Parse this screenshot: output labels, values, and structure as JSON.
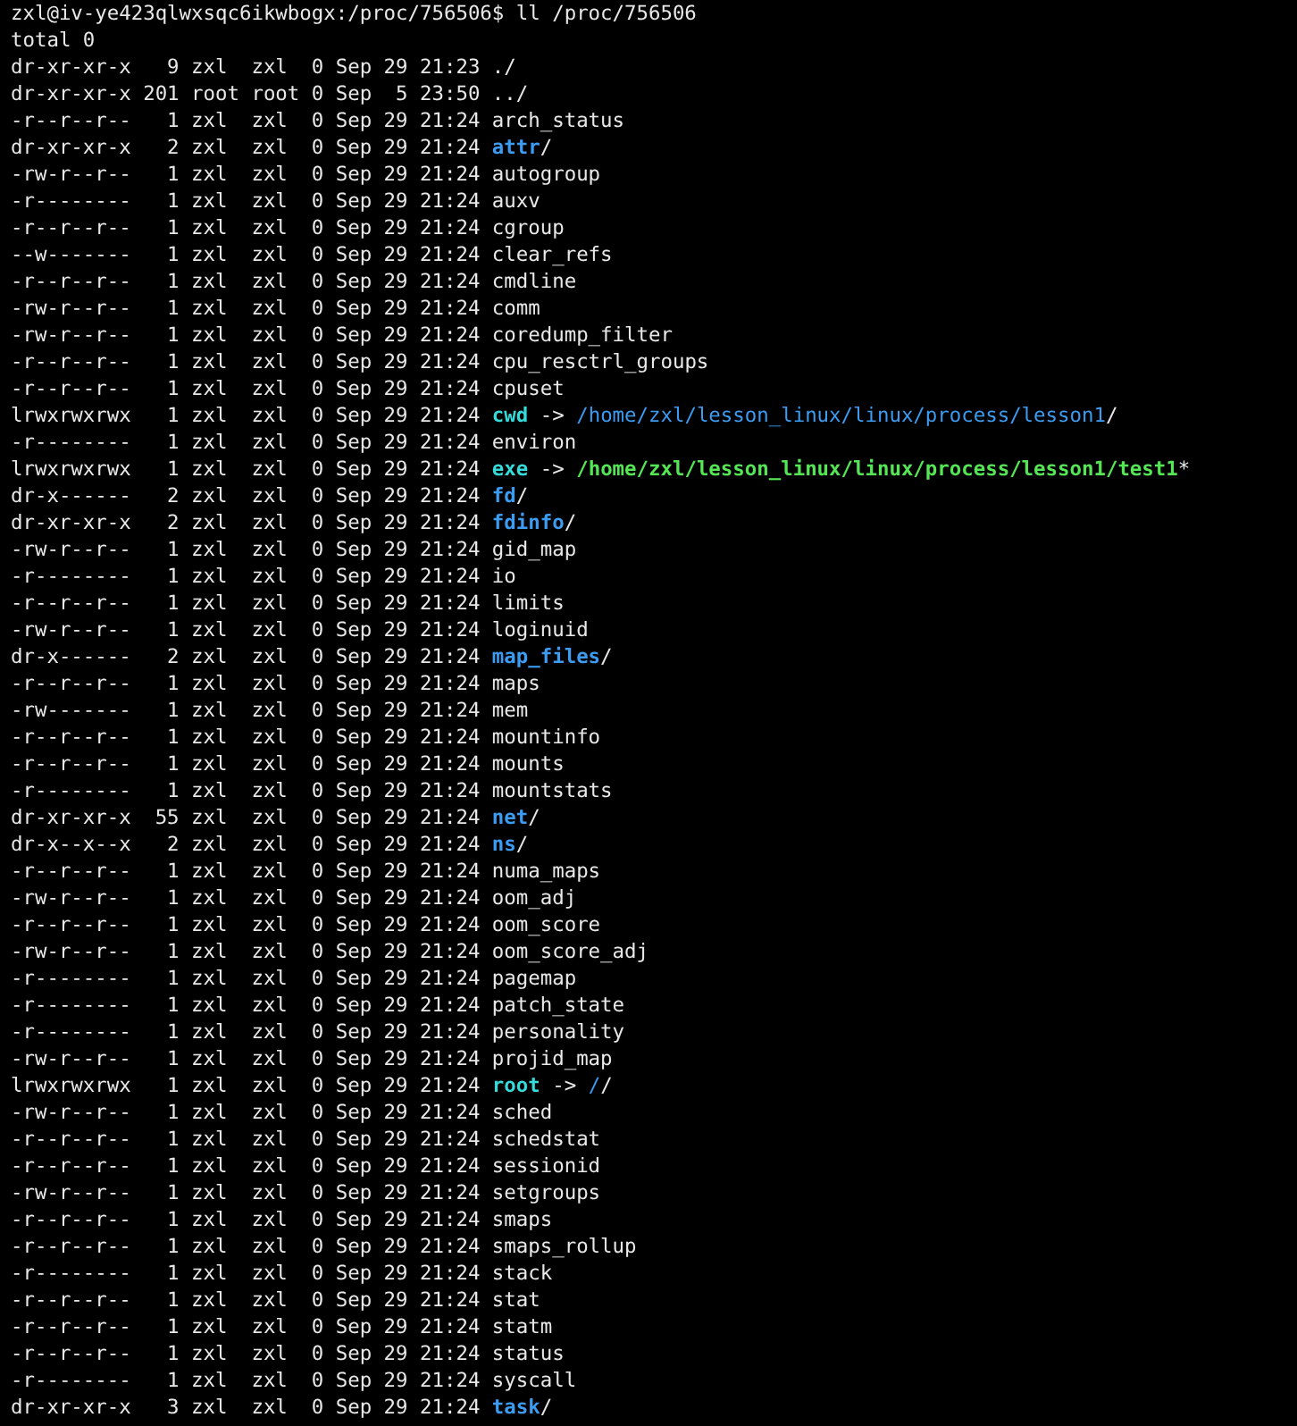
{
  "terminal": {
    "prompt": "zxl@iv-ye423qlwxsqc6ikwbogx:/proc/756506$ ll /proc/756506",
    "total": "total 0",
    "entries": [
      {
        "perms": "dr-xr-xr-x",
        "links": "9",
        "owner": "zxl",
        "group": "zxl",
        "size": "0",
        "date": "Sep 29",
        "time": "21:23",
        "name": ".",
        "kind": "plain",
        "suffix": "/"
      },
      {
        "perms": "dr-xr-xr-x",
        "links": "201",
        "owner": "root",
        "group": "root",
        "size": "0",
        "date": "Sep  5",
        "time": "23:50",
        "name": "..",
        "kind": "plain",
        "suffix": "/"
      },
      {
        "perms": "-r--r--r--",
        "links": "1",
        "owner": "zxl",
        "group": "zxl",
        "size": "0",
        "date": "Sep 29",
        "time": "21:24",
        "name": "arch_status",
        "kind": "plain"
      },
      {
        "perms": "dr-xr-xr-x",
        "links": "2",
        "owner": "zxl",
        "group": "zxl",
        "size": "0",
        "date": "Sep 29",
        "time": "21:24",
        "name": "attr",
        "kind": "dir",
        "suffix": "/"
      },
      {
        "perms": "-rw-r--r--",
        "links": "1",
        "owner": "zxl",
        "group": "zxl",
        "size": "0",
        "date": "Sep 29",
        "time": "21:24",
        "name": "autogroup",
        "kind": "plain"
      },
      {
        "perms": "-r--------",
        "links": "1",
        "owner": "zxl",
        "group": "zxl",
        "size": "0",
        "date": "Sep 29",
        "time": "21:24",
        "name": "auxv",
        "kind": "plain"
      },
      {
        "perms": "-r--r--r--",
        "links": "1",
        "owner": "zxl",
        "group": "zxl",
        "size": "0",
        "date": "Sep 29",
        "time": "21:24",
        "name": "cgroup",
        "kind": "plain"
      },
      {
        "perms": "--w-------",
        "links": "1",
        "owner": "zxl",
        "group": "zxl",
        "size": "0",
        "date": "Sep 29",
        "time": "21:24",
        "name": "clear_refs",
        "kind": "plain"
      },
      {
        "perms": "-r--r--r--",
        "links": "1",
        "owner": "zxl",
        "group": "zxl",
        "size": "0",
        "date": "Sep 29",
        "time": "21:24",
        "name": "cmdline",
        "kind": "plain"
      },
      {
        "perms": "-rw-r--r--",
        "links": "1",
        "owner": "zxl",
        "group": "zxl",
        "size": "0",
        "date": "Sep 29",
        "time": "21:24",
        "name": "comm",
        "kind": "plain"
      },
      {
        "perms": "-rw-r--r--",
        "links": "1",
        "owner": "zxl",
        "group": "zxl",
        "size": "0",
        "date": "Sep 29",
        "time": "21:24",
        "name": "coredump_filter",
        "kind": "plain"
      },
      {
        "perms": "-r--r--r--",
        "links": "1",
        "owner": "zxl",
        "group": "zxl",
        "size": "0",
        "date": "Sep 29",
        "time": "21:24",
        "name": "cpu_resctrl_groups",
        "kind": "plain"
      },
      {
        "perms": "-r--r--r--",
        "links": "1",
        "owner": "zxl",
        "group": "zxl",
        "size": "0",
        "date": "Sep 29",
        "time": "21:24",
        "name": "cpuset",
        "kind": "plain"
      },
      {
        "perms": "lrwxrwxrwx",
        "links": "1",
        "owner": "zxl",
        "group": "zxl",
        "size": "0",
        "date": "Sep 29",
        "time": "21:24",
        "name": "cwd",
        "kind": "link",
        "arrow": "->",
        "target": {
          "path": "/home/zxl/lesson_linux/linux/process/lesson1",
          "kind": "dir"
        },
        "suffix": "/"
      },
      {
        "perms": "-r--------",
        "links": "1",
        "owner": "zxl",
        "group": "zxl",
        "size": "0",
        "date": "Sep 29",
        "time": "21:24",
        "name": "environ",
        "kind": "plain"
      },
      {
        "perms": "lrwxrwxrwx",
        "links": "1",
        "owner": "zxl",
        "group": "zxl",
        "size": "0",
        "date": "Sep 29",
        "time": "21:24",
        "name": "exe",
        "kind": "link",
        "arrow": "->",
        "target": {
          "path": "/home/zxl/lesson_linux/linux/process/lesson1/test1",
          "kind": "exec"
        },
        "suffix": "*"
      },
      {
        "perms": "dr-x------",
        "links": "2",
        "owner": "zxl",
        "group": "zxl",
        "size": "0",
        "date": "Sep 29",
        "time": "21:24",
        "name": "fd",
        "kind": "dir",
        "suffix": "/"
      },
      {
        "perms": "dr-xr-xr-x",
        "links": "2",
        "owner": "zxl",
        "group": "zxl",
        "size": "0",
        "date": "Sep 29",
        "time": "21:24",
        "name": "fdinfo",
        "kind": "dir",
        "suffix": "/"
      },
      {
        "perms": "-rw-r--r--",
        "links": "1",
        "owner": "zxl",
        "group": "zxl",
        "size": "0",
        "date": "Sep 29",
        "time": "21:24",
        "name": "gid_map",
        "kind": "plain"
      },
      {
        "perms": "-r--------",
        "links": "1",
        "owner": "zxl",
        "group": "zxl",
        "size": "0",
        "date": "Sep 29",
        "time": "21:24",
        "name": "io",
        "kind": "plain"
      },
      {
        "perms": "-r--r--r--",
        "links": "1",
        "owner": "zxl",
        "group": "zxl",
        "size": "0",
        "date": "Sep 29",
        "time": "21:24",
        "name": "limits",
        "kind": "plain"
      },
      {
        "perms": "-rw-r--r--",
        "links": "1",
        "owner": "zxl",
        "group": "zxl",
        "size": "0",
        "date": "Sep 29",
        "time": "21:24",
        "name": "loginuid",
        "kind": "plain"
      },
      {
        "perms": "dr-x------",
        "links": "2",
        "owner": "zxl",
        "group": "zxl",
        "size": "0",
        "date": "Sep 29",
        "time": "21:24",
        "name": "map_files",
        "kind": "dir",
        "suffix": "/"
      },
      {
        "perms": "-r--r--r--",
        "links": "1",
        "owner": "zxl",
        "group": "zxl",
        "size": "0",
        "date": "Sep 29",
        "time": "21:24",
        "name": "maps",
        "kind": "plain"
      },
      {
        "perms": "-rw-------",
        "links": "1",
        "owner": "zxl",
        "group": "zxl",
        "size": "0",
        "date": "Sep 29",
        "time": "21:24",
        "name": "mem",
        "kind": "plain"
      },
      {
        "perms": "-r--r--r--",
        "links": "1",
        "owner": "zxl",
        "group": "zxl",
        "size": "0",
        "date": "Sep 29",
        "time": "21:24",
        "name": "mountinfo",
        "kind": "plain"
      },
      {
        "perms": "-r--r--r--",
        "links": "1",
        "owner": "zxl",
        "group": "zxl",
        "size": "0",
        "date": "Sep 29",
        "time": "21:24",
        "name": "mounts",
        "kind": "plain"
      },
      {
        "perms": "-r--------",
        "links": "1",
        "owner": "zxl",
        "group": "zxl",
        "size": "0",
        "date": "Sep 29",
        "time": "21:24",
        "name": "mountstats",
        "kind": "plain"
      },
      {
        "perms": "dr-xr-xr-x",
        "links": "55",
        "owner": "zxl",
        "group": "zxl",
        "size": "0",
        "date": "Sep 29",
        "time": "21:24",
        "name": "net",
        "kind": "dir",
        "suffix": "/"
      },
      {
        "perms": "dr-x--x--x",
        "links": "2",
        "owner": "zxl",
        "group": "zxl",
        "size": "0",
        "date": "Sep 29",
        "time": "21:24",
        "name": "ns",
        "kind": "dir",
        "suffix": "/"
      },
      {
        "perms": "-r--r--r--",
        "links": "1",
        "owner": "zxl",
        "group": "zxl",
        "size": "0",
        "date": "Sep 29",
        "time": "21:24",
        "name": "numa_maps",
        "kind": "plain"
      },
      {
        "perms": "-rw-r--r--",
        "links": "1",
        "owner": "zxl",
        "group": "zxl",
        "size": "0",
        "date": "Sep 29",
        "time": "21:24",
        "name": "oom_adj",
        "kind": "plain"
      },
      {
        "perms": "-r--r--r--",
        "links": "1",
        "owner": "zxl",
        "group": "zxl",
        "size": "0",
        "date": "Sep 29",
        "time": "21:24",
        "name": "oom_score",
        "kind": "plain"
      },
      {
        "perms": "-rw-r--r--",
        "links": "1",
        "owner": "zxl",
        "group": "zxl",
        "size": "0",
        "date": "Sep 29",
        "time": "21:24",
        "name": "oom_score_adj",
        "kind": "plain"
      },
      {
        "perms": "-r--------",
        "links": "1",
        "owner": "zxl",
        "group": "zxl",
        "size": "0",
        "date": "Sep 29",
        "time": "21:24",
        "name": "pagemap",
        "kind": "plain"
      },
      {
        "perms": "-r--------",
        "links": "1",
        "owner": "zxl",
        "group": "zxl",
        "size": "0",
        "date": "Sep 29",
        "time": "21:24",
        "name": "patch_state",
        "kind": "plain"
      },
      {
        "perms": "-r--------",
        "links": "1",
        "owner": "zxl",
        "group": "zxl",
        "size": "0",
        "date": "Sep 29",
        "time": "21:24",
        "name": "personality",
        "kind": "plain"
      },
      {
        "perms": "-rw-r--r--",
        "links": "1",
        "owner": "zxl",
        "group": "zxl",
        "size": "0",
        "date": "Sep 29",
        "time": "21:24",
        "name": "projid_map",
        "kind": "plain"
      },
      {
        "perms": "lrwxrwxrwx",
        "links": "1",
        "owner": "zxl",
        "group": "zxl",
        "size": "0",
        "date": "Sep 29",
        "time": "21:24",
        "name": "root",
        "kind": "link",
        "arrow": "->",
        "target": {
          "path": "/",
          "kind": "dir"
        },
        "suffix": "/"
      },
      {
        "perms": "-rw-r--r--",
        "links": "1",
        "owner": "zxl",
        "group": "zxl",
        "size": "0",
        "date": "Sep 29",
        "time": "21:24",
        "name": "sched",
        "kind": "plain"
      },
      {
        "perms": "-r--r--r--",
        "links": "1",
        "owner": "zxl",
        "group": "zxl",
        "size": "0",
        "date": "Sep 29",
        "time": "21:24",
        "name": "schedstat",
        "kind": "plain"
      },
      {
        "perms": "-r--r--r--",
        "links": "1",
        "owner": "zxl",
        "group": "zxl",
        "size": "0",
        "date": "Sep 29",
        "time": "21:24",
        "name": "sessionid",
        "kind": "plain"
      },
      {
        "perms": "-rw-r--r--",
        "links": "1",
        "owner": "zxl",
        "group": "zxl",
        "size": "0",
        "date": "Sep 29",
        "time": "21:24",
        "name": "setgroups",
        "kind": "plain"
      },
      {
        "perms": "-r--r--r--",
        "links": "1",
        "owner": "zxl",
        "group": "zxl",
        "size": "0",
        "date": "Sep 29",
        "time": "21:24",
        "name": "smaps",
        "kind": "plain"
      },
      {
        "perms": "-r--r--r--",
        "links": "1",
        "owner": "zxl",
        "group": "zxl",
        "size": "0",
        "date": "Sep 29",
        "time": "21:24",
        "name": "smaps_rollup",
        "kind": "plain"
      },
      {
        "perms": "-r--------",
        "links": "1",
        "owner": "zxl",
        "group": "zxl",
        "size": "0",
        "date": "Sep 29",
        "time": "21:24",
        "name": "stack",
        "kind": "plain"
      },
      {
        "perms": "-r--r--r--",
        "links": "1",
        "owner": "zxl",
        "group": "zxl",
        "size": "0",
        "date": "Sep 29",
        "time": "21:24",
        "name": "stat",
        "kind": "plain"
      },
      {
        "perms": "-r--r--r--",
        "links": "1",
        "owner": "zxl",
        "group": "zxl",
        "size": "0",
        "date": "Sep 29",
        "time": "21:24",
        "name": "statm",
        "kind": "plain"
      },
      {
        "perms": "-r--r--r--",
        "links": "1",
        "owner": "zxl",
        "group": "zxl",
        "size": "0",
        "date": "Sep 29",
        "time": "21:24",
        "name": "status",
        "kind": "plain"
      },
      {
        "perms": "-r--------",
        "links": "1",
        "owner": "zxl",
        "group": "zxl",
        "size": "0",
        "date": "Sep 29",
        "time": "21:24",
        "name": "syscall",
        "kind": "plain"
      },
      {
        "perms": "dr-xr-xr-x",
        "links": "3",
        "owner": "zxl",
        "group": "zxl",
        "size": "0",
        "date": "Sep 29",
        "time": "21:24",
        "name": "task",
        "kind": "dir",
        "suffix": "/"
      }
    ]
  }
}
